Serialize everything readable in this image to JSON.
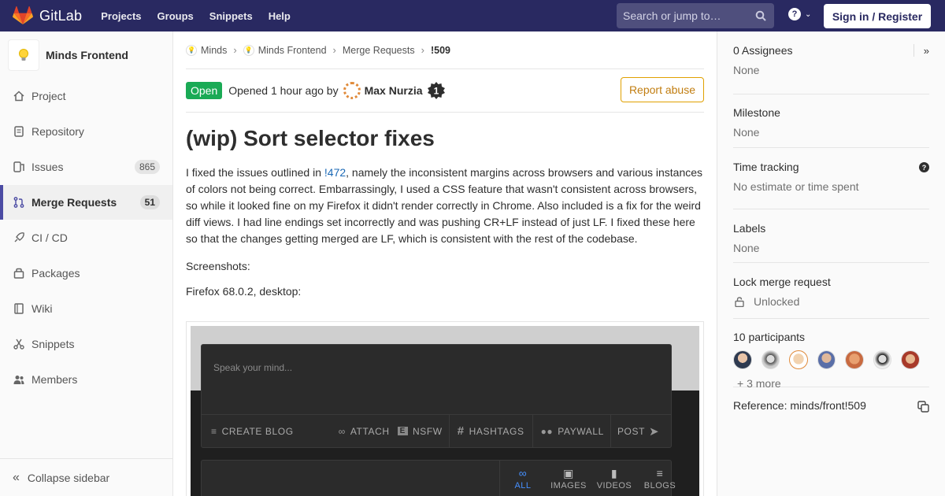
{
  "app": {
    "name": "GitLab"
  },
  "nav": {
    "links": [
      "Projects",
      "Groups",
      "Snippets",
      "Help"
    ],
    "search_placeholder": "Search or jump to…",
    "signin_label": "Sign in / Register",
    "help_glyph": "?"
  },
  "sidebar": {
    "project_name": "Minds Frontend",
    "items": [
      {
        "label": "Project",
        "icon": "home-icon"
      },
      {
        "label": "Repository",
        "icon": "doc-icon"
      },
      {
        "label": "Issues",
        "count": "865",
        "icon": "issues-icon"
      },
      {
        "label": "Merge Requests",
        "count": "51",
        "icon": "merge-request-icon",
        "active": true
      },
      {
        "label": "CI / CD",
        "icon": "rocket-icon"
      },
      {
        "label": "Packages",
        "icon": "package-icon"
      },
      {
        "label": "Wiki",
        "icon": "book-icon"
      },
      {
        "label": "Snippets",
        "icon": "scissors-icon"
      },
      {
        "label": "Members",
        "icon": "users-icon"
      }
    ],
    "collapse_label": "Collapse sidebar"
  },
  "breadcrumb": {
    "items": [
      "Minds",
      "Minds Frontend",
      "Merge Requests",
      "!509"
    ]
  },
  "mr": {
    "status": "Open",
    "opened_text": "Opened 1 hour ago by",
    "author": "Max Nurzia",
    "author_badge": "1",
    "report_label": "Report abuse",
    "title": "(wip) Sort selector fixes",
    "desc_before": "I fixed the issues outlined in ",
    "desc_link": "!472",
    "desc_after": ", namely the inconsistent margins across browsers and various instances of colors not being correct. Embarrassingly, I used a CSS feature that wasn't consistent across browsers, so while it looked fine on my Firefox it didn't render correctly in Chrome. Also included is a fix for the weird diff views. I had line endings set incorrectly and was pushing CR+LF instead of just LF. I fixed these here so that the changes getting merged are LF, which is consistent with the rest of the codebase.",
    "screenshots_label": "Screenshots:",
    "firefox_label": "Firefox 68.0.2, desktop:"
  },
  "screenshot": {
    "composer_placeholder": "Speak your mind...",
    "toolbar": [
      "CREATE BLOG",
      "ATTACH",
      "NSFW",
      "HASHTAGS",
      "PAYWALL",
      "POST"
    ],
    "feed_tabs": [
      "ALL",
      "IMAGES",
      "VIDEOS",
      "BLOGS"
    ],
    "active_tab": "ALL"
  },
  "right": {
    "assignees_title": "0 Assignees",
    "assignees_value": "None",
    "milestone_title": "Milestone",
    "milestone_value": "None",
    "time_title": "Time tracking",
    "time_value": "No estimate or time spent",
    "labels_title": "Labels",
    "labels_value": "None",
    "lock_title": "Lock merge request",
    "lock_value": "Unlocked",
    "participants_title": "10 participants",
    "more_label": "+ 3 more",
    "reference": "Reference: minds/front!509"
  },
  "colors": {
    "topbar": "#292961",
    "status_open": "#1aaa55",
    "link": "#1b69b6",
    "report": "#c17d10"
  }
}
